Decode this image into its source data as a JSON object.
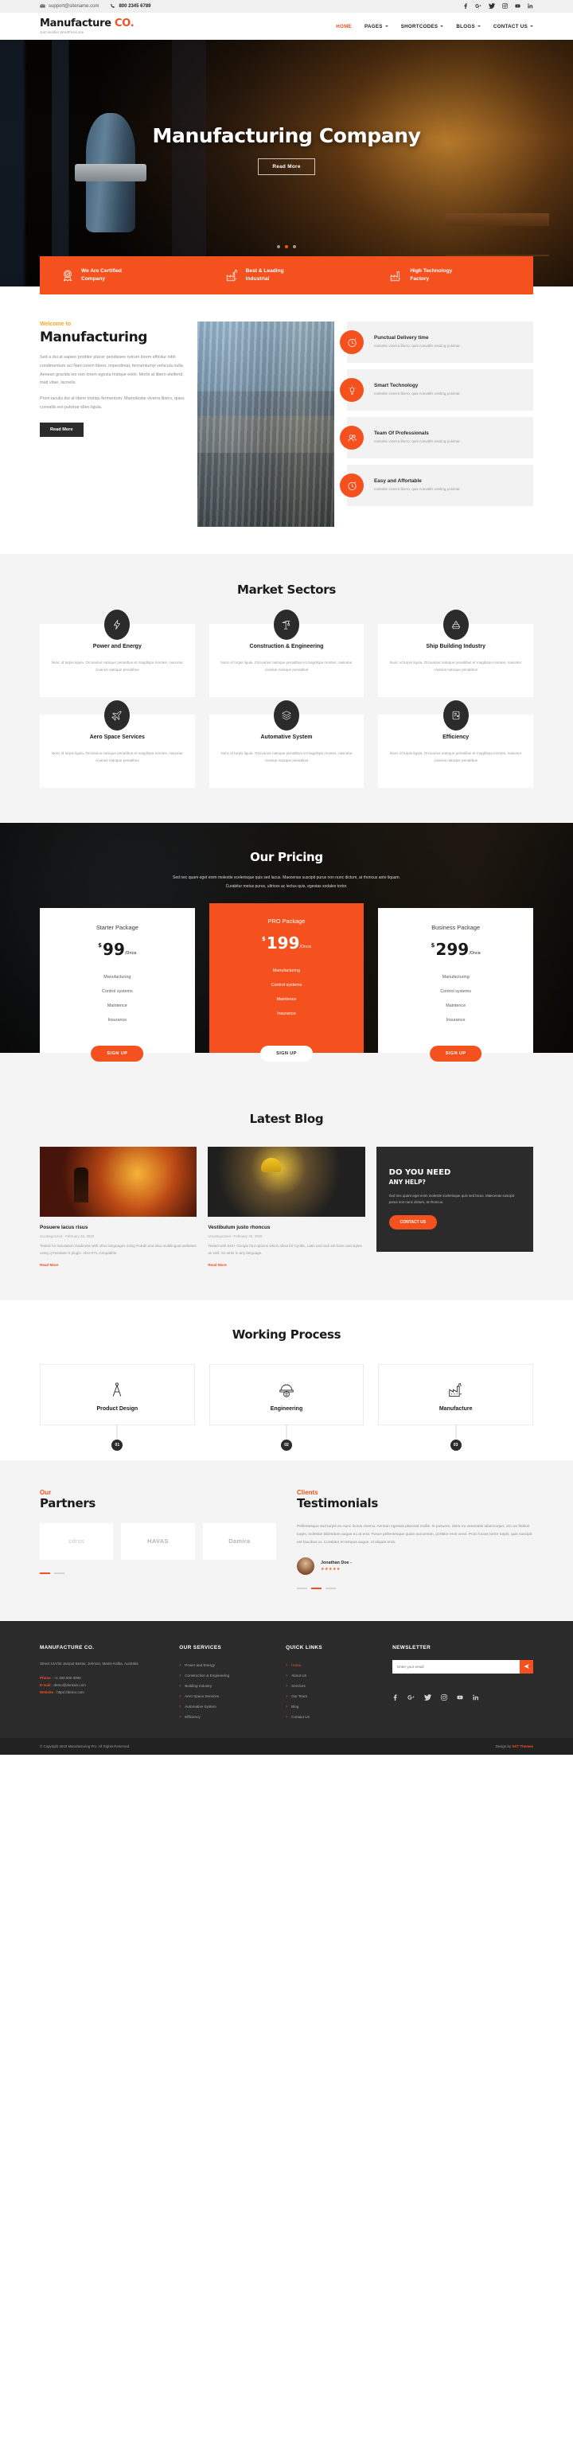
{
  "topbar": {
    "email": "support@sitename.com",
    "phone": "800 2345 6789",
    "socials": [
      "facebook-icon",
      "google-plus-icon",
      "twitter-icon",
      "instagram-icon",
      "youtube-icon",
      "linkedin-icon"
    ]
  },
  "header": {
    "logo_main": "Manufacture",
    "logo_accent": "CO.",
    "tagline": "Just another WordPress site",
    "menu": [
      {
        "label": "HOME",
        "active": true,
        "caret": false
      },
      {
        "label": "PAGES",
        "active": false,
        "caret": true
      },
      {
        "label": "SHORTCODES",
        "active": false,
        "caret": true
      },
      {
        "label": "BLOGS",
        "active": false,
        "caret": true
      },
      {
        "label": "CONTACT US",
        "active": false,
        "caret": true
      }
    ]
  },
  "hero": {
    "title": "Manufacturing Company",
    "button": "Read More",
    "slide_count": 3,
    "active_slide": 2
  },
  "feature_bar": [
    {
      "icon": "certificate-badge-icon",
      "line1": "We Are Certified",
      "line2": "Company"
    },
    {
      "icon": "factory-icon",
      "line1": "Best & Leading",
      "line2": "Industrial"
    },
    {
      "icon": "factory-tech-icon",
      "line1": "High Technology",
      "line2": "Factory"
    }
  ],
  "about": {
    "kicker": "Welcome to",
    "heading": "Manufacturing",
    "paragraph1": "Sed a dui at sapien porttitor placer pendissee rutrum lorem efficitur nibh condimentum aci Nam lorem libero, imperdimat, fermentumyi vehicula nulla. Aenean gravida leo non lorem egesta tristque extin. Morbi at libero eleifend, matt vitae, lacnelis.",
    "paragraph2": "Proin iaculis dui at libero tristiqu fermentum. Mamolestie viverra libero, quiss convallis est pulvinar idleo ligula.",
    "button": "Read More",
    "features": [
      {
        "icon": "stopwatch-icon",
        "title": "Punctual Delivery time",
        "desc": "molestie viverra libero, quis convallis essting pulvinar."
      },
      {
        "icon": "lightbulb-icon",
        "title": "Smart Technology",
        "desc": "molestie viverra libero, quis convallis essting pulvinar."
      },
      {
        "icon": "team-icon",
        "title": "Team Of Professionals",
        "desc": "molestie viverra libero, quis convallis essting pulvinar."
      },
      {
        "icon": "stopwatch-icon",
        "title": "Easy and Affortable",
        "desc": "molestie viverra libero, quis convallis essting pulvinar."
      }
    ]
  },
  "sectors": {
    "title": "Market Sectors",
    "items": [
      {
        "icon": "lightning-bolt-icon",
        "name": "Power and Energy",
        "desc": "Nunc id turpis ligula. Orcivarius natoque penatibus et magdispa montes, nascetur civarius natoque penatibus"
      },
      {
        "icon": "crane-icon",
        "name": "Construction & Engineering",
        "desc": "Nunc id turpis ligula. Orcivarius natoque penatibus et magdispa montes, nascetur civarius natoque penatibus"
      },
      {
        "icon": "ship-icon",
        "name": "Ship Building Industry",
        "desc": "Nunc id turpis ligula. Orcivarius natoque penatibus et magdispa montes, nascetur civarius natoque penatibus"
      },
      {
        "icon": "airplane-icon",
        "name": "Aero Space Services",
        "desc": "Nunc id turpis ligula. Orcivarius natoque penatibus et magdispa montes, nascetur civarius natoque penatibus"
      },
      {
        "icon": "layers-icon",
        "name": "Automative System",
        "desc": "Nunc id turpis ligula. Orcivarius natoque penatibus et magdispa montes, nascetur civarius natoque penatibus"
      },
      {
        "icon": "gauge-icon",
        "name": "Efficiency",
        "desc": "Nunc id turpis ligula. Orcivarius natoque penatibus et magdispa montes, nascetur civarius natoque penatibus"
      }
    ]
  },
  "pricing": {
    "title": "Our Pricing",
    "subtitle_line1": "Sed nec quam eget enim molestie scelerisque quis sed lacus. Maecenas suscipit purus non nunc dictum, at rhoncus ante liquam.",
    "subtitle_line2": "Curabitur metus purus, ultrices ac lectus quis, egestas sodales tortor.",
    "plans": [
      {
        "name": "Starter Package",
        "currency": "$",
        "amount": "99",
        "period": "/Once",
        "featured": false,
        "features": [
          "Manufacturing",
          "Control systems",
          "Maintence",
          "Insurance"
        ],
        "cta": "SIGN UP"
      },
      {
        "name": "PRO Package",
        "currency": "$",
        "amount": "199",
        "period": "/Once",
        "featured": true,
        "features": [
          "Manufacturing",
          "Control systems",
          "Maintence",
          "Insurance"
        ],
        "cta": "SIGN UP"
      },
      {
        "name": "Business Package",
        "currency": "$",
        "amount": "299",
        "period": "/Once",
        "featured": false,
        "features": [
          "Manufacturing",
          "Control systems",
          "Maintence",
          "Insurance"
        ],
        "cta": "SIGN UP"
      }
    ]
  },
  "blog": {
    "title": "Latest Blog",
    "posts": [
      {
        "title": "Posuere lacus risus",
        "meta": "Uncategorized - February 26, 2020",
        "excerpt": "Tested for translation readiness with other languages using PoEdit and also multilingual websites using qTranslate-X plugin. Also RTL compatible.",
        "more": "Read More"
      },
      {
        "title": "Vestibulum justo rhoncus",
        "meta": "Uncategorized - February 26, 2020",
        "excerpt": "Tested with 640+ Google font options which allow for Cyrillic, Latin and Sub set fonts and styles as well. So write in any language.",
        "more": "Read More"
      }
    ],
    "help": {
      "line1": "DO YOU NEED",
      "line2": "ANY HELP?",
      "text": "Sed nec quam eget enim molestie scelerisque quis sed lacus. Maecenas suscipit purus non nunc dictum, at rhoncus.",
      "cta": "CONTACT US"
    }
  },
  "process": {
    "title": "Working Process",
    "steps": [
      {
        "icon": "compass-divider-icon",
        "name": "Product Design",
        "num": "01"
      },
      {
        "icon": "engineer-helmet-icon",
        "name": "Engineering",
        "num": "02"
      },
      {
        "icon": "factory-manufacture-icon",
        "name": "Manufacture",
        "num": "03"
      }
    ]
  },
  "partners": {
    "kicker": "Our",
    "heading": "Partners",
    "logos": [
      "citrus",
      "HAVAS",
      "Damira"
    ],
    "pager": [
      true,
      false
    ]
  },
  "testimonials": {
    "kicker": "Clients",
    "heading": "Testimonials",
    "text": "Pellentesque sed turpis eu nunc luctus viverra. Aenean egestas placerat mollis. In posuere, dolor eu venenatis ullamcorper, orci ex finibus turpis, molestie bibendum augue eu at erat. Fusce pellentesque quam accumsan, porttitor eros vend. Proin luctus tortor turpis, quis suscipit est faucibus ut. Curabitur et tempus augue, id aliquet eros.",
    "author": "Jonathan Doe -",
    "rating": "★★★★★",
    "pager": [
      false,
      true,
      false
    ]
  },
  "footer": {
    "company": {
      "heading": "MANUFACTURE CO.",
      "address": "Street 13A/32 Jampot Bestor, Jehrson, Martin Kalba, Australia",
      "phone_label": "Phone :",
      "phone_value": "+1 300 000 0000",
      "email_label": "E-mail :",
      "email_value": "demo@domain.com",
      "web_label": "Website :",
      "web_value": "https://demo.com"
    },
    "services": {
      "heading": "OUR SERVICES",
      "items": [
        "Power and Energy",
        "Construction & Engineering",
        "Building Industry",
        "Aero Space Services",
        "Automative System",
        "Efficiency"
      ]
    },
    "quick": {
      "heading": "QUICK LINKS",
      "items": [
        "Home",
        "About Us",
        "Services",
        "Our Team",
        "Blog",
        "Contact Us"
      ]
    },
    "newsletter": {
      "heading": "NEWSLETTER",
      "placeholder": "Enter your email",
      "button": "send-icon",
      "socials": [
        "facebook-icon",
        "google-plus-icon",
        "twitter-icon",
        "instagram-icon",
        "youtube-icon",
        "linkedin-icon"
      ]
    },
    "bottom_left": "© Copyright 2019 Manufacturing Pro. All Rights Reserved.",
    "bottom_right_prefix": "Design by",
    "bottom_right_brand": "SKT Themes"
  },
  "colors": {
    "accent": "#f4511e",
    "dark": "#2b2b2b",
    "light_bg": "#f4f4f4",
    "yellow": "#f9a825"
  }
}
